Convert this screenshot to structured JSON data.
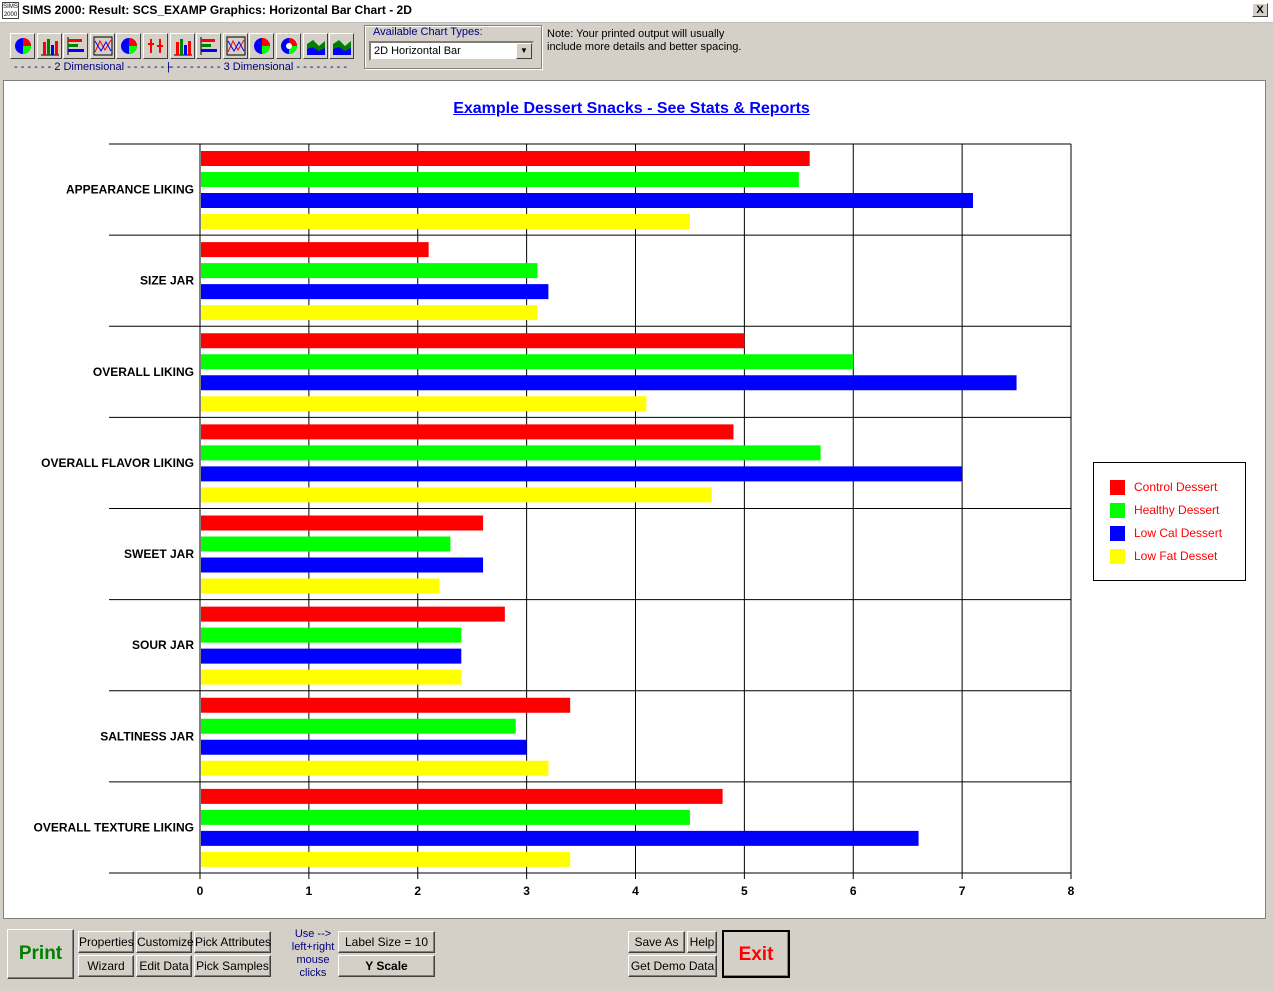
{
  "window": {
    "title": "SIMS 2000:  Result: SCS_EXAMP  Graphics:  Horizontal Bar Chart - 2D",
    "icon_text": "SIMS 2000",
    "close_label": "X"
  },
  "toolbar": {
    "icons_2d": [
      "dial-chart-icon",
      "vertical-bar-chart-icon",
      "horizontal-bar-chart-icon",
      "line-chart-icon",
      "pie-chart-icon",
      "high-low-chart-icon"
    ],
    "icons_3d": [
      "vertical-bar-3d-icon",
      "horizontal-bar-3d-icon",
      "line-3d-icon",
      "pie-3d-icon",
      "doughnut-3d-icon",
      "area-3d-icon",
      "stacked-3d-icon"
    ],
    "label_2d": "- - - - - -  2 Dimensional  - - - - - - -",
    "label_3d": "|- - - - - - - -  3 Dimensional  - - - - - - - -",
    "chart_types_label": "Available Chart Types:",
    "chart_type_selected": "2D Horizontal Bar",
    "note_line1": "Note:  Your printed output will usually",
    "note_line2": "include more details and better spacing."
  },
  "colors": {
    "control": "#ff0000",
    "healthy": "#00ff00",
    "lowcal": "#0000ff",
    "lowfat": "#ffff00"
  },
  "chart_data": {
    "type": "bar",
    "orientation": "horizontal",
    "title": "Example Dessert Snacks - See Stats & Reports",
    "categories": [
      "APPEARANCE LIKING",
      "SIZE JAR",
      "OVERALL LIKING",
      "OVERALL FLAVOR LIKING",
      "SWEET JAR",
      "SOUR JAR",
      "SALTINESS JAR",
      "OVERALL TEXTURE LIKING"
    ],
    "series": [
      {
        "name": "Control Dessert",
        "color": "#ff0000",
        "values": [
          5.6,
          2.1,
          5.0,
          4.9,
          2.6,
          2.8,
          3.4,
          4.8
        ]
      },
      {
        "name": "Healthy Dessert",
        "color": "#00ff00",
        "values": [
          5.5,
          3.1,
          6.0,
          5.7,
          2.3,
          2.4,
          2.9,
          4.5
        ]
      },
      {
        "name": "Low Cal Dessert",
        "color": "#0000ff",
        "values": [
          7.1,
          3.2,
          7.5,
          7.0,
          2.6,
          2.4,
          3.0,
          6.6
        ]
      },
      {
        "name": "Low Fat Desset",
        "color": "#ffff00",
        "values": [
          4.5,
          3.1,
          4.1,
          4.7,
          2.2,
          2.4,
          3.2,
          3.4
        ]
      }
    ],
    "xlim": [
      0,
      8
    ],
    "xticks": [
      "0",
      "1",
      "2",
      "3",
      "4",
      "5",
      "6",
      "7",
      "8"
    ],
    "grid": true,
    "legend_position": "right"
  },
  "bottom": {
    "print_label": "Print",
    "properties_label": "Properties",
    "customize_label": "Customize",
    "pick_attributes_label": "Pick Attributes",
    "wizard_label": "Wizard",
    "edit_data_label": "Edit Data",
    "pick_samples_label": "Pick Samples",
    "mouse_hint": "Use --> left+right mouse clicks",
    "label_size_label": "Label Size = 10",
    "y_scale_label": "Y Scale",
    "save_as_label": "Save As",
    "help_label": "Help",
    "demo_data_label": "Get Demo Data",
    "exit_label": "Exit"
  }
}
